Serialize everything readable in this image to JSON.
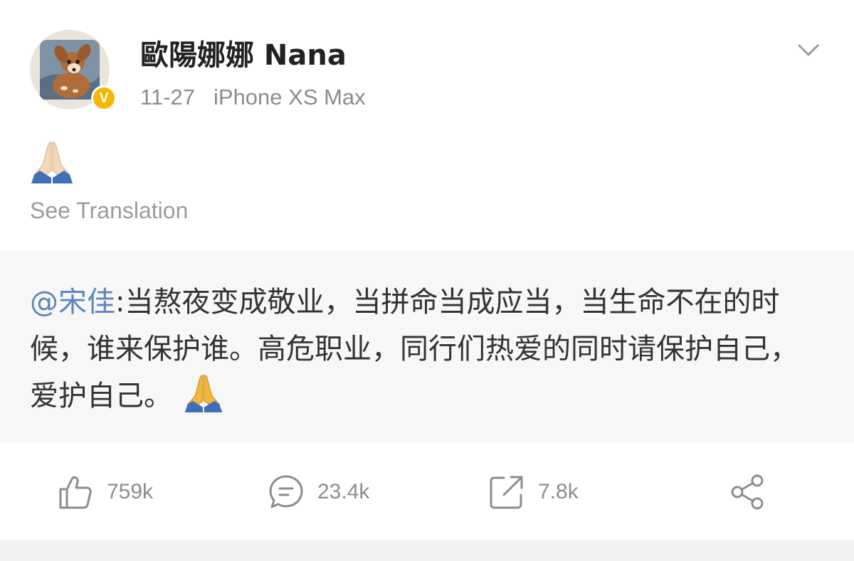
{
  "post": {
    "author": "歐陽娜娜 Nana",
    "date": "11-27",
    "device": "iPhone XS Max",
    "see_translation": "See Translation",
    "menu_icon": "chevron-down-icon",
    "avatar_icon": "avatar-deer-icon",
    "verified_badge": "V",
    "body_emoji": "praying-hands-icon"
  },
  "repost": {
    "mention": "@宋佳",
    "text": ":当熬夜变成敬业，当拼命当成应当，当生命不在的时候，谁来保护谁。高危职业，同行们热爱的同时请保护自己，爱护自己。",
    "trailing_emoji": "praying-hands-icon"
  },
  "actions": {
    "like_count": "759k",
    "comment_count": "23.4k",
    "repost_count": "7.8k",
    "like_icon": "thumbs-up-icon",
    "comment_icon": "comment-icon",
    "repost_icon": "repost-icon",
    "share_icon": "share-icon"
  },
  "colors": {
    "mention": "#5b86b8",
    "verified": "#f5b800",
    "muted_text": "#8c8c8c",
    "repost_bg": "#f7f7f7"
  }
}
